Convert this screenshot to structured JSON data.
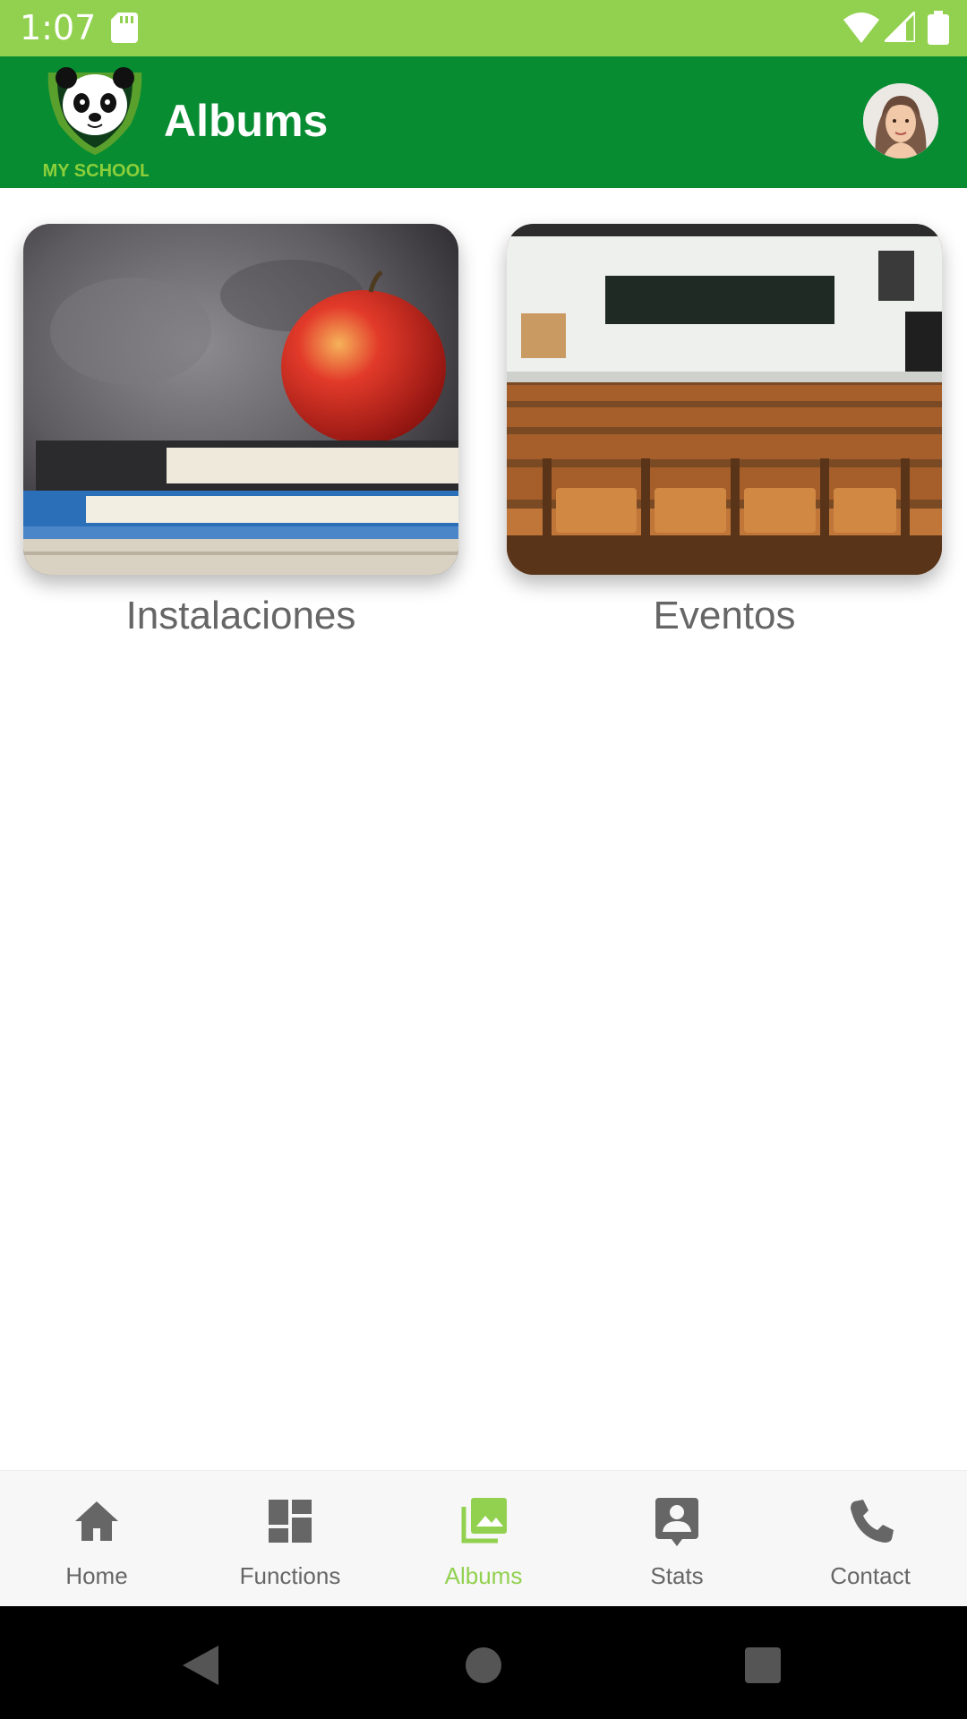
{
  "status_bar": {
    "time": "1:07"
  },
  "app_bar": {
    "title": "Albums"
  },
  "albums": [
    {
      "label": "Instalaciones"
    },
    {
      "label": "Eventos"
    }
  ],
  "bottom_nav": {
    "items": [
      {
        "label": "Home",
        "icon": "home-icon"
      },
      {
        "label": "Functions",
        "icon": "dashboard-icon"
      },
      {
        "label": "Albums",
        "icon": "photo-album-icon"
      },
      {
        "label": "Stats",
        "icon": "account-box-icon"
      },
      {
        "label": "Contact",
        "icon": "phone-icon"
      }
    ],
    "active_index": 2
  },
  "logo": {
    "text": "MY SCHOOL"
  },
  "colors": {
    "status_bar": "#92d14f",
    "app_bar": "#078c32",
    "nav_active": "#92d14f",
    "nav_inactive": "#666666"
  }
}
